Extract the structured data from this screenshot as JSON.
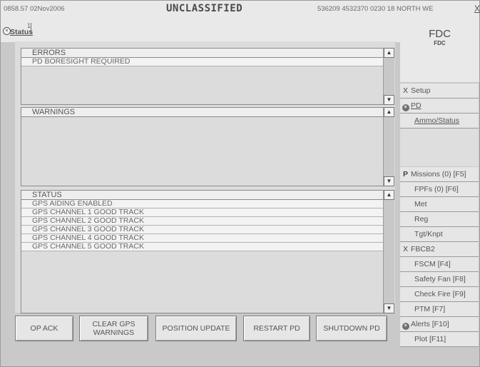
{
  "topbar": {
    "datetime": "0858.57 02Nov2006",
    "classification": "UNCLASSIFIED",
    "coordinates": "536209 4532370 0230 18 NORTH WE",
    "close_label": "X"
  },
  "tab": {
    "label": "Status",
    "number": "1"
  },
  "fdc": {
    "title": "FDC",
    "subtitle": "FDC"
  },
  "errors": {
    "header": "ERRORS",
    "rows": [
      "PD BORESIGHT REQUIRED"
    ]
  },
  "warnings": {
    "header": "WARNINGS",
    "rows": []
  },
  "status": {
    "header": "STATUS",
    "rows": [
      "GPS AIDING ENABLED",
      "GPS CHANNEL 1 GOOD TRACK",
      "GPS CHANNEL 2 GOOD TRACK",
      "GPS CHANNEL 3 GOOD TRACK",
      "GPS CHANNEL 4 GOOD TRACK",
      "GPS CHANNEL 5 GOOD TRACK"
    ]
  },
  "buttons": {
    "op_ack": "OP ACK",
    "clear_gps": "CLEAR GPS\nWARNINGS",
    "position_update": "POSITION UPDATE",
    "restart_pd": "RESTART PD",
    "shutdown_pd": "SHUTDOWN PD"
  },
  "sidebar": {
    "setup": "Setup",
    "pd": "PD",
    "ammo_status": "Ammo/Status",
    "missions": "Missions (0) [F5]",
    "fpfs": "FPFs (0)  [F6]",
    "met": "Met",
    "reg": "Reg",
    "tgt_knpt": "Tgt/Knpt",
    "fbcb2": "FBCB2",
    "fscm": "FSCM [F4]",
    "safety_fan": "Safety Fan [F8]",
    "check_fire": "Check Fire [F9]",
    "ptm": "PTM [F7]",
    "alerts": "Alerts [F10]",
    "plot": "Plot [F11]",
    "p_marker": "P",
    "x_marker": "X"
  },
  "scroll": {
    "up": "▲",
    "down": "▼"
  }
}
